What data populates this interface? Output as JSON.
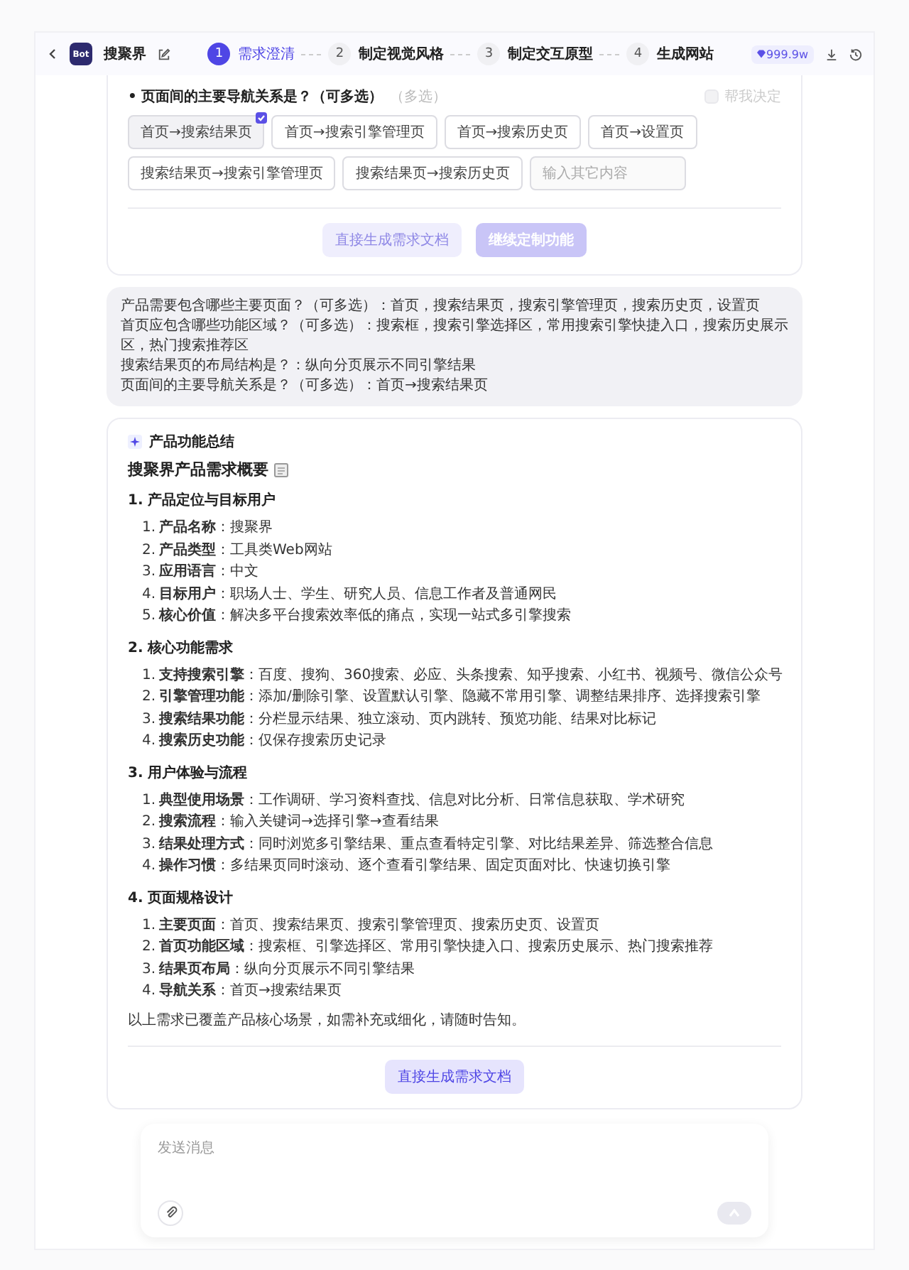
{
  "header": {
    "logo": "Bot",
    "title": "搜聚界",
    "credits": "999.9w",
    "steps": [
      {
        "number": "1",
        "label": "需求澄清",
        "selected": true
      },
      {
        "number": "2",
        "label": "制定视觉风格",
        "selected": false
      },
      {
        "number": "3",
        "label": "制定交互原型",
        "selected": false
      },
      {
        "number": "4",
        "label": "生成网站",
        "selected": false
      }
    ]
  },
  "question": {
    "bullet": "•",
    "text": "页面间的主要导航关系是？（可多选）",
    "hint": "（多选）",
    "decide": {
      "label": "帮我决定",
      "checked": false
    },
    "options": [
      {
        "label": "首页→搜索结果页",
        "selected": true
      },
      {
        "label": "首页→搜索引擎管理页",
        "selected": false
      },
      {
        "label": "首页→搜索历史页",
        "selected": false
      },
      {
        "label": "首页→设置页",
        "selected": false
      },
      {
        "label": "搜索结果页→搜索引擎管理页",
        "selected": false
      },
      {
        "label": "搜索结果页→搜索历史页",
        "selected": false
      }
    ],
    "custom_placeholder": "输入其它内容",
    "buttons": [
      {
        "label": "直接生成需求文档",
        "kind": "secondary",
        "disabled": true
      },
      {
        "label": "继续定制功能",
        "kind": "primary",
        "disabled": true
      }
    ]
  },
  "user_message": [
    "产品需要包含哪些主要页面？（可多选）：首页，搜索结果页，搜索引擎管理页，搜索历史页，设置页",
    "首页应包含哪些功能区域？（可多选）：搜索框，搜索引擎选择区，常用搜索引擎快捷入口，搜索历史展示区，热门搜索推荐区",
    "搜索结果页的布局结构是？：纵向分页展示不同引擎结果",
    "页面间的主要导航关系是？（可多选）：首页→搜索结果页"
  ],
  "summary": {
    "label": "产品功能总结",
    "title": "搜聚界产品需求概要",
    "sections": [
      {
        "heading": "1. 产品定位与目标用户",
        "items": [
          {
            "number": "1.",
            "text": "**产品名称**：搜聚界"
          },
          {
            "number": "2.",
            "text": "**产品类型**：工具类Web网站"
          },
          {
            "number": "3.",
            "text": "**应用语言**：中文"
          },
          {
            "number": "4.",
            "text": "**目标用户**：职场人士、学生、研究人员、信息工作者及普通网民"
          },
          {
            "number": "5.",
            "text": "**核心价值**：解决多平台搜索效率低的痛点，实现一站式多引擎搜索"
          }
        ]
      },
      {
        "heading": "2. 核心功能需求",
        "items": [
          {
            "number": "1.",
            "text": "**支持搜索引擎**：百度、搜狗、360搜索、必应、头条搜索、知乎搜索、小红书、视频号、微信公众号"
          },
          {
            "number": "2.",
            "text": "**引擎管理功能**：添加/删除引擎、设置默认引擎、隐藏不常用引擎、调整结果排序、选择搜索引擎"
          },
          {
            "number": "3.",
            "text": "**搜索结果功能**：分栏显示结果、独立滚动、页内跳转、预览功能、结果对比标记"
          },
          {
            "number": "4.",
            "text": "**搜索历史功能**：仅保存搜索历史记录"
          }
        ]
      },
      {
        "heading": "3. 用户体验与流程",
        "items": [
          {
            "number": "1.",
            "text": "**典型使用场景**：工作调研、学习资料查找、信息对比分析、日常信息获取、学术研究"
          },
          {
            "number": "2.",
            "text": "**搜索流程**：输入关键词→选择引擎→查看结果"
          },
          {
            "number": "3.",
            "text": "**结果处理方式**：同时浏览多引擎结果、重点查看特定引擎、对比结果差异、筛选整合信息"
          },
          {
            "number": "4.",
            "text": "**操作习惯**：多结果页同时滚动、逐个查看引擎结果、固定页面对比、快速切换引擎"
          }
        ]
      },
      {
        "heading": "4. 页面规格设计",
        "items": [
          {
            "number": "1.",
            "text": "**主要页面**：首页、搜索结果页、搜索引擎管理页、搜索历史页、设置页"
          },
          {
            "number": "2.",
            "text": "**首页功能区域**：搜索框、引擎选择区、常用引擎快捷入口、搜索历史展示、热门搜索推荐"
          },
          {
            "number": "3.",
            "text": "**结果页布局**：纵向分页展示不同引擎结果"
          },
          {
            "number": "4.",
            "text": "**导航关系**：首页→搜索结果页"
          }
        ]
      }
    ],
    "closing": "以上需求已覆盖产品核心场景，如需补充或细化，请随时告知。",
    "button": "直接生成需求文档"
  },
  "composer": {
    "placeholder": "发送消息"
  }
}
